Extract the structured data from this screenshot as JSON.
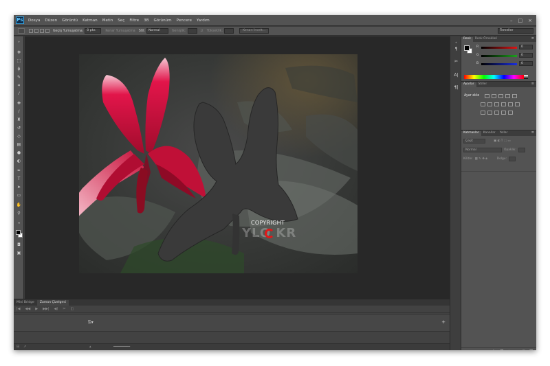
{
  "app": {
    "logo_text": "Ps"
  },
  "menu": [
    "Dosya",
    "Düzen",
    "Görüntü",
    "Katman",
    "Metin",
    "Seç",
    "Filtre",
    "3B",
    "Görünüm",
    "Pencere",
    "Yardım"
  ],
  "window_controls": {
    "minimize": "–",
    "restore": "□",
    "close": "×"
  },
  "options_bar": {
    "feather_label": "Geçiş Yumuşatma:",
    "feather_value": "0 pks",
    "antialias_label": "Kenar Yumuşatma",
    "style_label": "Stil:",
    "style_value": "Normal",
    "width_label": "Genişlik:",
    "height_label": "Yükseklik:",
    "refine_edge_label": "Kenarı İncelt...",
    "workspace_value": "Temeller"
  },
  "canvas": {
    "copyright_text": "COPYRIGHT",
    "watermark_text": "YLO  KR"
  },
  "timeline": {
    "tabs": [
      {
        "label": "Mini Bridge",
        "active": false
      },
      {
        "label": "Zaman Çizelgesi",
        "active": true
      }
    ],
    "controls": [
      "|◀",
      "◀◀",
      "▶",
      "▶▶|",
      "◀)",
      "✂",
      "◫"
    ],
    "film_icon": "⎘▾",
    "add_icon": "+"
  },
  "panels": {
    "color": {
      "tabs": [
        {
          "label": "Renk",
          "active": true
        },
        {
          "label": "Renk Örnekleri",
          "active": false
        }
      ],
      "sliders": [
        {
          "label": "R",
          "value": "0",
          "color": "#e01414"
        },
        {
          "label": "G",
          "value": "0",
          "color": "#1ea01e"
        },
        {
          "label": "B",
          "value": "0",
          "color": "#1a2ee0"
        }
      ]
    },
    "adjustments": {
      "tabs": [
        {
          "label": "Ayarlar",
          "active": true
        },
        {
          "label": "Stiller",
          "active": false
        }
      ],
      "title": "Ayar ekle"
    },
    "layers": {
      "tabs": [
        {
          "label": "Katmanlar",
          "active": true
        },
        {
          "label": "Kanallar",
          "active": false
        },
        {
          "label": "Yollar",
          "active": false
        }
      ],
      "kind_label": "Çeşit",
      "blend_mode": "Normal",
      "opacity_label": "Opaklık:",
      "lock_label": "Kilitle:",
      "fill_label": "Dolgu:"
    }
  }
}
